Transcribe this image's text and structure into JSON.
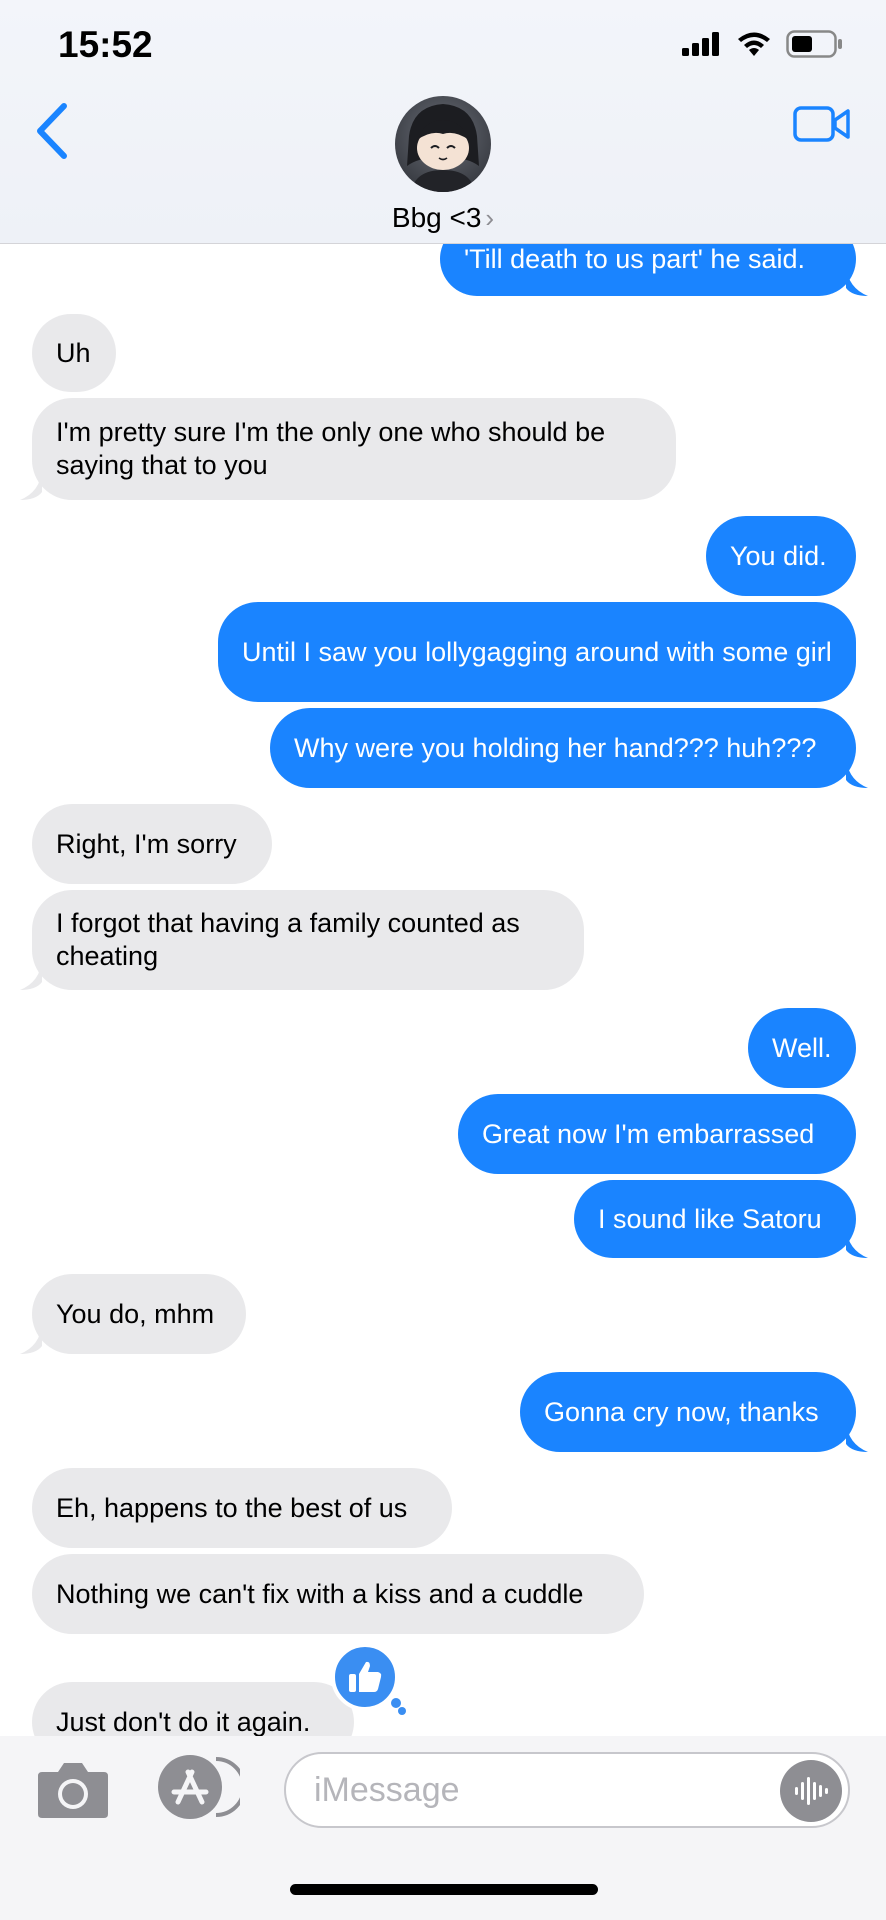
{
  "status_bar": {
    "time": "15:52"
  },
  "header": {
    "contact_name": "Bbg <3",
    "chevron": "›"
  },
  "messages": [
    {
      "dir": "out",
      "text": "'Till death to us part' he said."
    },
    {
      "dir": "in",
      "text": "Uh"
    },
    {
      "dir": "in",
      "text": "I'm pretty sure I'm the only one who should be saying that to you"
    },
    {
      "dir": "out",
      "text": "You did."
    },
    {
      "dir": "out",
      "text": "Until I saw you lollygagging around with some girl"
    },
    {
      "dir": "out",
      "text": "Why were you holding her hand??? huh???"
    },
    {
      "dir": "in",
      "text": "Right, I'm sorry"
    },
    {
      "dir": "in",
      "text": "I forgot that having a family counted as cheating"
    },
    {
      "dir": "out",
      "text": "Well."
    },
    {
      "dir": "out",
      "text": "Great now I'm embarrassed"
    },
    {
      "dir": "out",
      "text": "I sound like Satoru"
    },
    {
      "dir": "in",
      "text": "You do, mhm"
    },
    {
      "dir": "out",
      "text": "Gonna cry now, thanks"
    },
    {
      "dir": "in",
      "text": "Eh, happens to the best of us"
    },
    {
      "dir": "in",
      "text": "Nothing we can't fix with a kiss and a cuddle"
    },
    {
      "dir": "in",
      "text": "Just don't do it again."
    }
  ],
  "tapback": {
    "icon": "thumbs-up-icon"
  },
  "composer": {
    "placeholder": "iMessage"
  },
  "colors": {
    "outgoing": "#1a84ff",
    "incoming": "#e9e9eb",
    "accent": "#1a84ff"
  },
  "icons": [
    "back-chevron-icon",
    "video-call-icon",
    "camera-icon",
    "app-store-icon",
    "audio-waveform-icon",
    "thumbs-up-icon"
  ]
}
